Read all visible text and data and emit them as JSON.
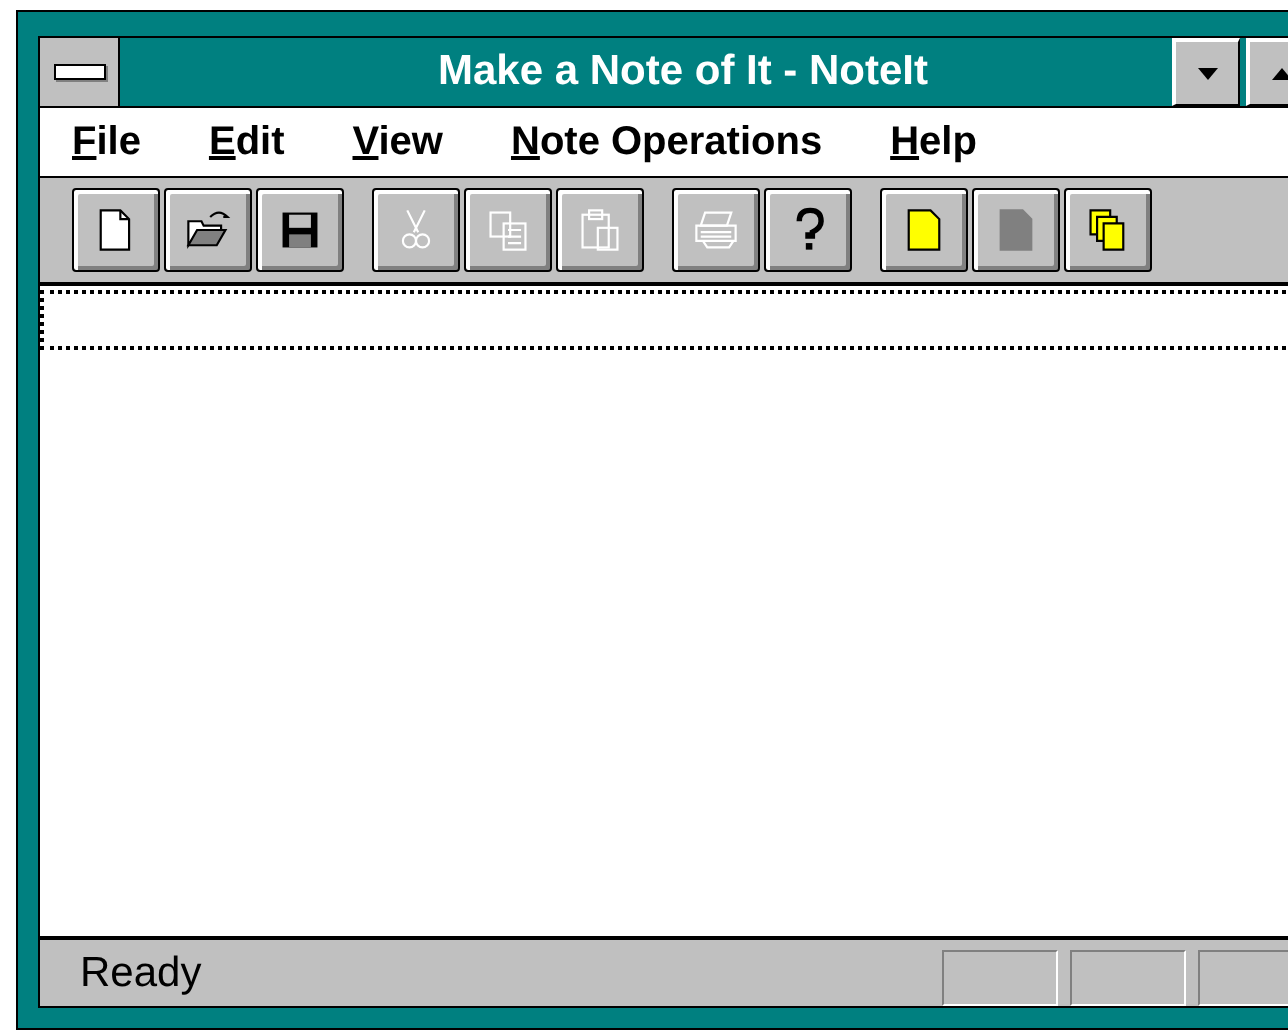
{
  "window": {
    "title": "Make a Note of It - NoteIt"
  },
  "menu": [
    {
      "label": "File"
    },
    {
      "label": "Edit"
    },
    {
      "label": "View"
    },
    {
      "label": "Note Operations"
    },
    {
      "label": "Help"
    }
  ],
  "toolbar": [
    [
      {
        "kind": "new",
        "disabled": false
      },
      {
        "kind": "open",
        "disabled": false
      },
      {
        "kind": "save",
        "disabled": false
      }
    ],
    [
      {
        "kind": "cut",
        "disabled": true
      },
      {
        "kind": "copy",
        "disabled": true
      },
      {
        "kind": "paste",
        "disabled": true
      }
    ],
    [
      {
        "kind": "print",
        "disabled": true
      },
      {
        "kind": "help",
        "disabled": false
      }
    ],
    [
      {
        "kind": "note",
        "disabled": false
      },
      {
        "kind": "note",
        "disabled": true
      },
      {
        "kind": "stack",
        "disabled": false
      }
    ]
  ],
  "status_bar": {
    "text": "Ready"
  }
}
